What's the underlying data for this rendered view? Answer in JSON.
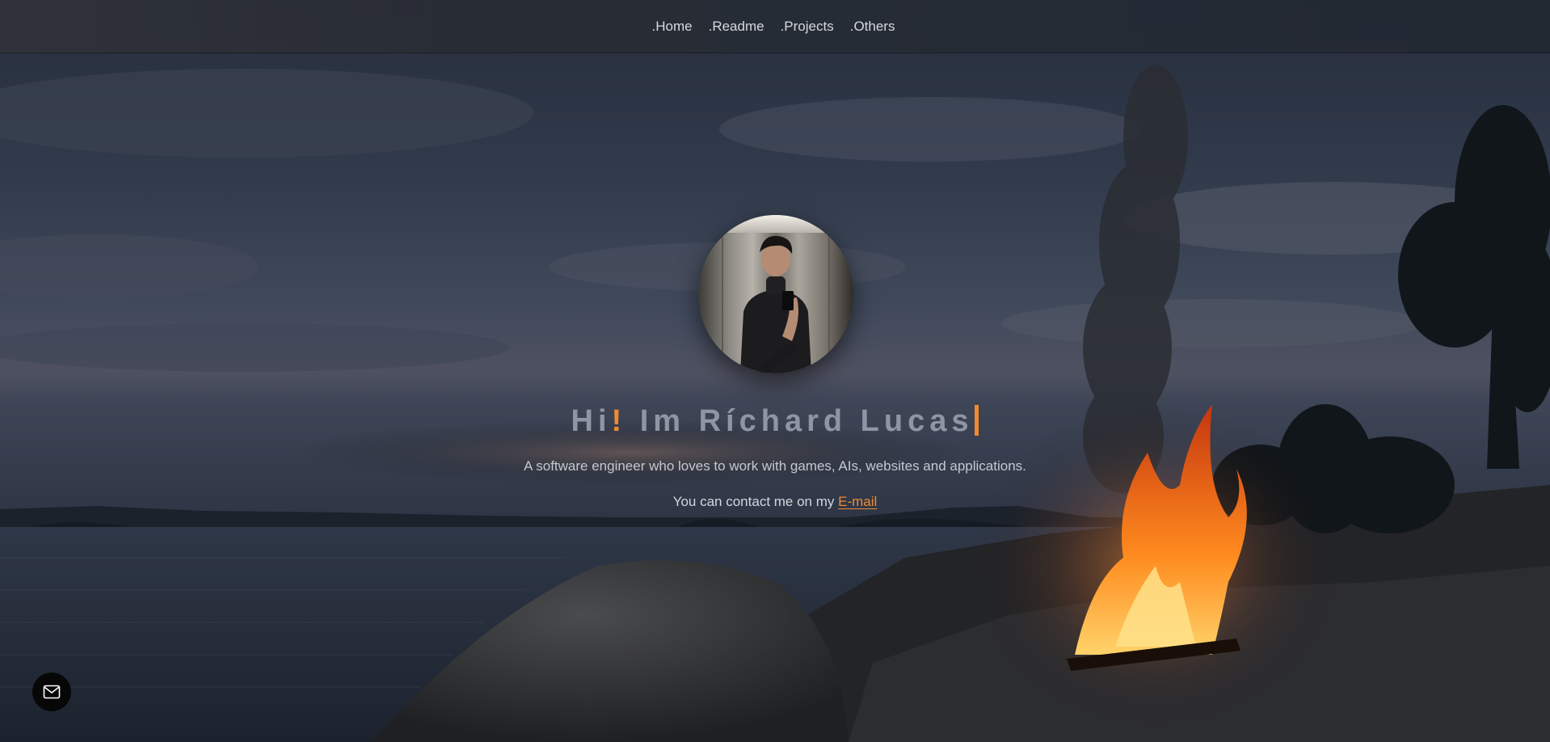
{
  "nav": {
    "items": [
      ".Home",
      ".Readme",
      ".Projects",
      ".Others"
    ]
  },
  "hero": {
    "title_part1": "Hi",
    "title_accent": "!",
    "title_part2": " Im Ríchard Lucas",
    "subtitle": "A software engineer who loves to work with games, AIs, websites and applications.",
    "contact_prefix": "You can contact me on my ",
    "contact_link": "E-mail"
  },
  "floating_button": {
    "icon": "mail-icon"
  },
  "colors": {
    "accent": "#f08a31",
    "title": "#8f96a3",
    "text": "#c4c8cf",
    "nav_bg": "#2b3039"
  }
}
